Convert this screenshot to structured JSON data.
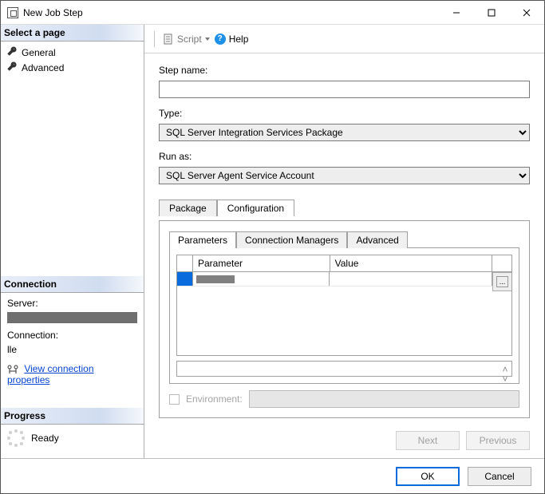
{
  "window": {
    "title": "New Job Step"
  },
  "left": {
    "select_page": "Select a page",
    "pages": [
      "General",
      "Advanced"
    ],
    "connection_header": "Connection",
    "server_label": "Server:",
    "connection_label": "Connection:",
    "connection_value": "lle",
    "view_props": "View connection properties",
    "progress_header": "Progress",
    "progress_status": "Ready"
  },
  "toolbar": {
    "script": "Script",
    "help": "Help"
  },
  "form": {
    "step_name_label": "Step name:",
    "step_name_value": "",
    "type_label": "Type:",
    "type_value": "SQL Server Integration Services Package",
    "run_as_label": "Run as:",
    "run_as_value": "SQL Server Agent Service Account"
  },
  "outer_tabs": [
    "Package",
    "Configuration"
  ],
  "outer_active": 1,
  "inner_tabs": [
    "Parameters",
    "Connection Managers",
    "Advanced"
  ],
  "inner_active": 0,
  "grid": {
    "headers": {
      "parameter": "Parameter",
      "value": "Value"
    },
    "rows": [
      {
        "parameter": "",
        "value": ""
      }
    ],
    "ellipsis": "..."
  },
  "env": {
    "label": "Environment:"
  },
  "nav": {
    "next": "Next",
    "previous": "Previous"
  },
  "footer": {
    "ok": "OK",
    "cancel": "Cancel"
  }
}
